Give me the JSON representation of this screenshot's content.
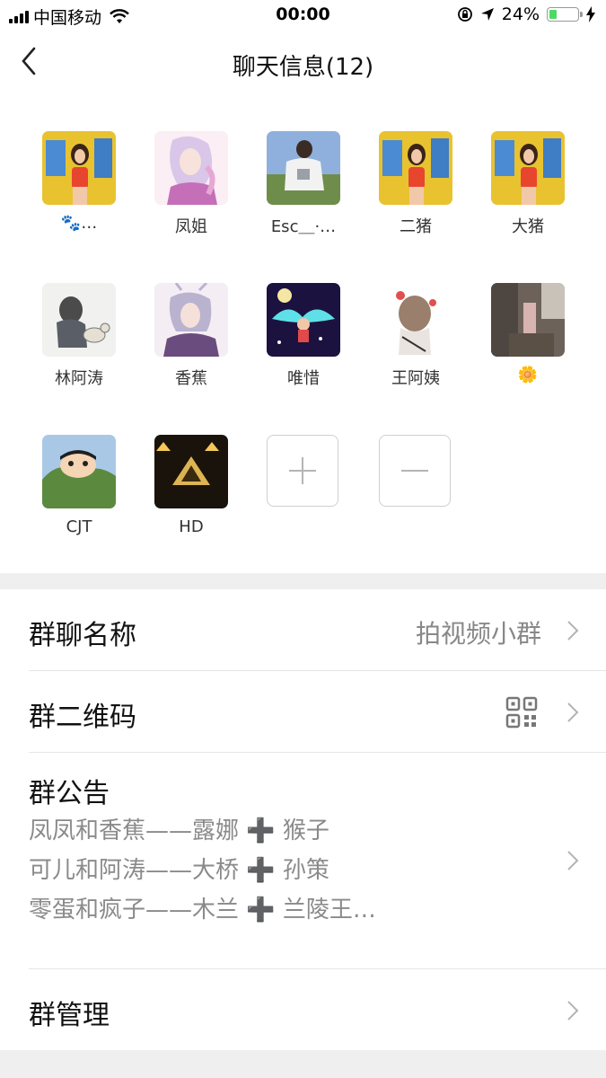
{
  "status_bar": {
    "carrier": "中国移动",
    "time": "00:00",
    "battery_percent": "24%"
  },
  "nav": {
    "title": "聊天信息(12)"
  },
  "members": [
    {
      "name": "🐾…",
      "avatar": "girl-yellow-bg"
    },
    {
      "name": "凤姐",
      "avatar": "anime-pink-hair"
    },
    {
      "name": "Esc＿·…",
      "avatar": "man-sitting-grass"
    },
    {
      "name": "二猪",
      "avatar": "girl-yellow-bg"
    },
    {
      "name": "大猪",
      "avatar": "girl-yellow-bg"
    },
    {
      "name": "林阿涛",
      "avatar": "sketch-man-dog"
    },
    {
      "name": "香蕉",
      "avatar": "anime-lilac-hair"
    },
    {
      "name": "唯惜",
      "avatar": "angel-night-sky"
    },
    {
      "name": "王阿姨",
      "avatar": "cartoon-girl-back"
    },
    {
      "name": "🌼",
      "avatar": "street-photo"
    },
    {
      "name": "CJT",
      "avatar": "crayon-shinchan"
    },
    {
      "name": "HD",
      "avatar": "lamp-triangles"
    }
  ],
  "actions": {
    "add_icon": "plus-icon",
    "remove_icon": "minus-icon"
  },
  "settings": {
    "group_name_label": "群聊名称",
    "group_name_value": "拍视频小群",
    "qrcode_label": "群二维码",
    "notice_label": "群公告",
    "notice_lines": [
      "凤凤和香蕉——露娜 ➕ 猴子",
      "可儿和阿涛——大桥 ➕ 孙策",
      "零蛋和疯子——木兰 ➕ 兰陵王…"
    ],
    "manage_label": "群管理"
  },
  "colors": {
    "divider_band": "#efefef",
    "secondary_text": "#888888",
    "battery_green": "#4cd964"
  }
}
